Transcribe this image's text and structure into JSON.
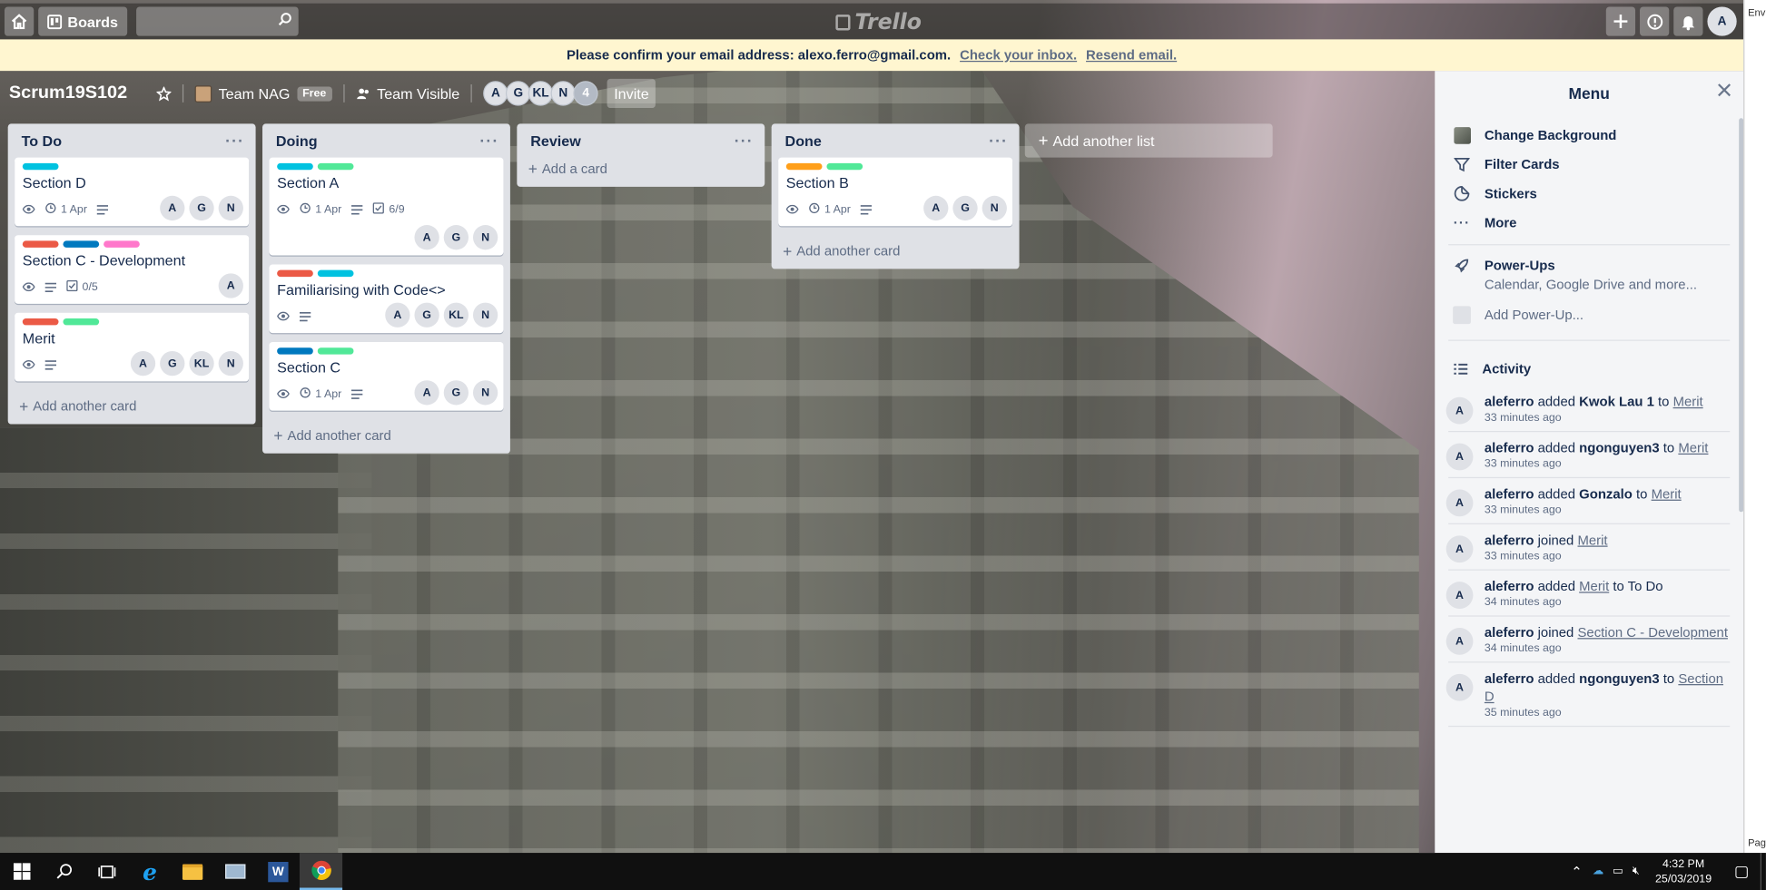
{
  "app": {
    "logo_text": "Trello"
  },
  "topbar": {
    "boards_label": "Boards",
    "search_placeholder": "",
    "user_initial": "A"
  },
  "banner": {
    "message": "Please confirm your email address: alexo.ferro@gmail.com.",
    "link_check": "Check your inbox.",
    "link_resend": "Resend email."
  },
  "board": {
    "title": "Scrum19S102",
    "team_name": "Team NAG",
    "team_plan": "Free",
    "visibility": "Team Visible",
    "members": [
      "A",
      "G",
      "KL",
      "N"
    ],
    "member_overflow": "4",
    "invite_label": "Invite"
  },
  "lists": [
    {
      "name": "To Do",
      "add_label": "Add another card",
      "cards": [
        {
          "labels": [
            "#00c2e0"
          ],
          "title": "Section D",
          "watch": true,
          "due": "1 Apr",
          "desc": true,
          "members": [
            "A",
            "G",
            "N"
          ]
        },
        {
          "labels": [
            "#eb5a46",
            "#0079bf",
            "#ff78cb"
          ],
          "title": "Section C - Development",
          "watch": true,
          "desc": true,
          "checklist": "0/5",
          "members": [
            "A"
          ]
        },
        {
          "labels": [
            "#eb5a46",
            "#51e898"
          ],
          "title": "Merit",
          "watch": true,
          "desc": true,
          "members": [
            "A",
            "G",
            "KL",
            "N"
          ]
        }
      ]
    },
    {
      "name": "Doing",
      "add_label": "Add another card",
      "cards": [
        {
          "labels": [
            "#00c2e0",
            "#51e898"
          ],
          "title": "Section A",
          "watch": true,
          "due": "1 Apr",
          "desc": true,
          "checklist": "6/9",
          "members": [
            "A",
            "G",
            "N"
          ]
        },
        {
          "labels": [
            "#eb5a46",
            "#00c2e0"
          ],
          "title": "Familiarising with Code<>",
          "watch": true,
          "desc": true,
          "members": [
            "A",
            "G",
            "KL",
            "N"
          ]
        },
        {
          "labels": [
            "#0079bf",
            "#51e898"
          ],
          "title": "Section C",
          "watch": true,
          "due": "1 Apr",
          "desc": true,
          "members": [
            "A",
            "G",
            "N"
          ]
        }
      ]
    },
    {
      "name": "Review",
      "add_label": "Add a card",
      "cards": []
    },
    {
      "name": "Done",
      "add_label": "Add another card",
      "cards": [
        {
          "labels": [
            "#ff9f1a",
            "#51e898"
          ],
          "title": "Section B",
          "watch": true,
          "due": "1 Apr",
          "desc": true,
          "members": [
            "A",
            "G",
            "N"
          ]
        }
      ]
    }
  ],
  "add_list_label": "Add another list",
  "menu": {
    "title": "Menu",
    "items": [
      "Change Background",
      "Filter Cards",
      "Stickers",
      "More"
    ],
    "powerups_title": "Power-Ups",
    "powerups_sub": "Calendar, Google Drive and more...",
    "add_powerup": "Add Power-Up...",
    "activity_title": "Activity",
    "activity": [
      {
        "avatar": "A",
        "user": "aleferro",
        "verb": "added",
        "object": "Kwok Lau 1",
        "prep": "to",
        "target": "Merit",
        "time": "33 minutes ago"
      },
      {
        "avatar": "A",
        "user": "aleferro",
        "verb": "added",
        "object": "ngonguyen3",
        "prep": "to",
        "target": "Merit",
        "time": "33 minutes ago"
      },
      {
        "avatar": "A",
        "user": "aleferro",
        "verb": "added",
        "object": "Gonzalo",
        "prep": "to",
        "target": "Merit",
        "time": "33 minutes ago"
      },
      {
        "avatar": "A",
        "user": "aleferro",
        "verb": "joined",
        "object": "",
        "prep": "",
        "target": "Merit",
        "time": "33 minutes ago"
      },
      {
        "avatar": "A",
        "user": "aleferro",
        "verb": "added",
        "object": "",
        "prep": "",
        "target": "Merit",
        "suffix": "to To Do",
        "time": "34 minutes ago"
      },
      {
        "avatar": "A",
        "user": "aleferro",
        "verb": "joined",
        "object": "",
        "prep": "",
        "target": "Section C - Development",
        "time": "34 minutes ago"
      },
      {
        "avatar": "A",
        "user": "aleferro",
        "verb": "added",
        "object": "ngonguyen3",
        "prep": "to",
        "target": "Section D",
        "time": "35 minutes ago"
      }
    ]
  },
  "side_strip": {
    "top_text": "Env",
    "bottom_text": "Pag"
  },
  "taskbar": {
    "time": "4:32 PM",
    "date": "25/03/2019"
  }
}
